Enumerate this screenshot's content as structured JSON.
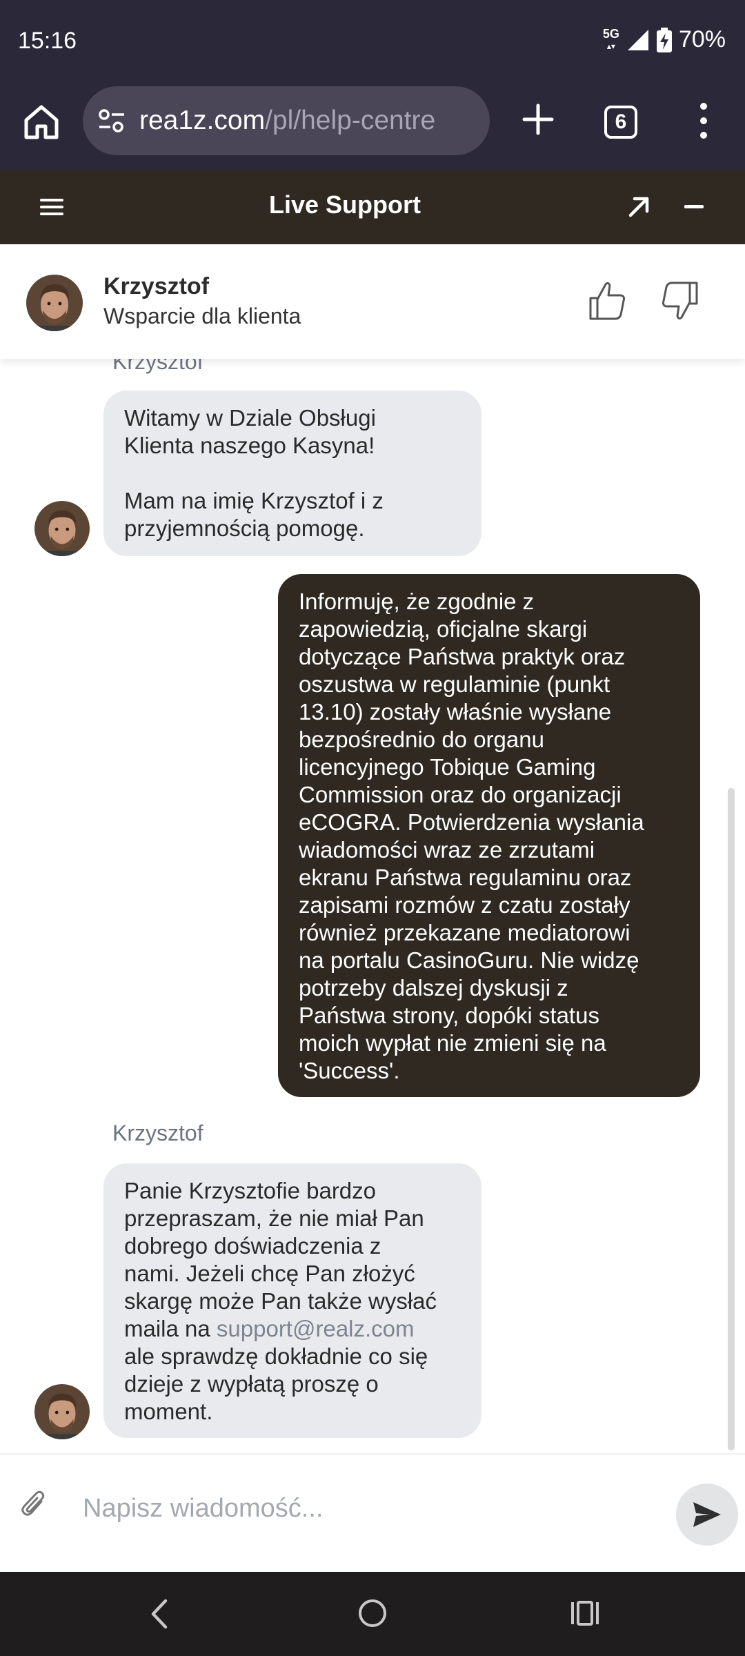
{
  "status_bar": {
    "time": "15:16",
    "network": "5G",
    "battery": "70%"
  },
  "browser": {
    "url_domain": "rea1z.com",
    "url_path": "/pl/help-centre",
    "tab_count": "6"
  },
  "chat_header": {
    "title": "Live Support"
  },
  "agent": {
    "name": "Krzysztof",
    "role": "Wsparcie dla klienta"
  },
  "messages": [
    {
      "sender": "Krzysztof",
      "type": "agent",
      "text": "Witamy w Dziale Obsługi\nKlienta naszego Kasyna!\n\nMam na imię Krzysztof i z\nprzyjemnością pomogę."
    },
    {
      "type": "user",
      "text": "Informuję, że zgodnie z\nzapowiedzią, oficjalne skargi\ndotyczące Państwa praktyk oraz\noszustwa w regulaminie (punkt\n13.10) zostały właśnie wysłane\nbezpośrednio do organu\nlicencyjnego Tobique Gaming\nCommission oraz do organizacji\neCOGRA. Potwierdzenia wysłania\nwiadomości wraz ze zrzutami\nekranu Państwa regulaminu oraz\nzapisami rozmów z czatu zostały\nrównież przekazane mediatorowi\nna portalu CasinoGuru. Nie widzę\npotrzeby dalszej dyskusji z\nPaństwa strony, dopóki status\nmoich wypłat nie zmieni się na\n'Success'."
    },
    {
      "sender": "Krzysztof",
      "type": "agent",
      "text_before_link": "Panie Krzysztofie bardzo\nprzepraszam, że nie miał Pan\ndobrego doświadczenia z\nnami. Jeżeli chcę Pan złożyć\nskargę może Pan także wysłać\nmaila na ",
      "link": "support@realz.com",
      "text_after_link": "\nale sprawdzę dokładnie co się\ndzieje z wypłatą proszę o\nmoment."
    }
  ],
  "composer": {
    "placeholder": "Napisz wiadomość..."
  },
  "icons": {
    "home": "home-icon",
    "site_settings": "tune-icon",
    "new_tab": "plus-icon",
    "menu": "more-vert-icon",
    "hamburger": "hamburger-icon",
    "expand": "arrow-up-right-icon",
    "minimize": "minus-icon",
    "like": "thumb-up-icon",
    "dislike": "thumb-down-icon",
    "attach": "paperclip-icon",
    "send": "send-icon"
  },
  "colors": {
    "browser_bg": "#2b2839",
    "chat_header_bg": "#2f2922",
    "user_bubble": "#2f2922",
    "agent_bubble": "#e9eaed"
  }
}
